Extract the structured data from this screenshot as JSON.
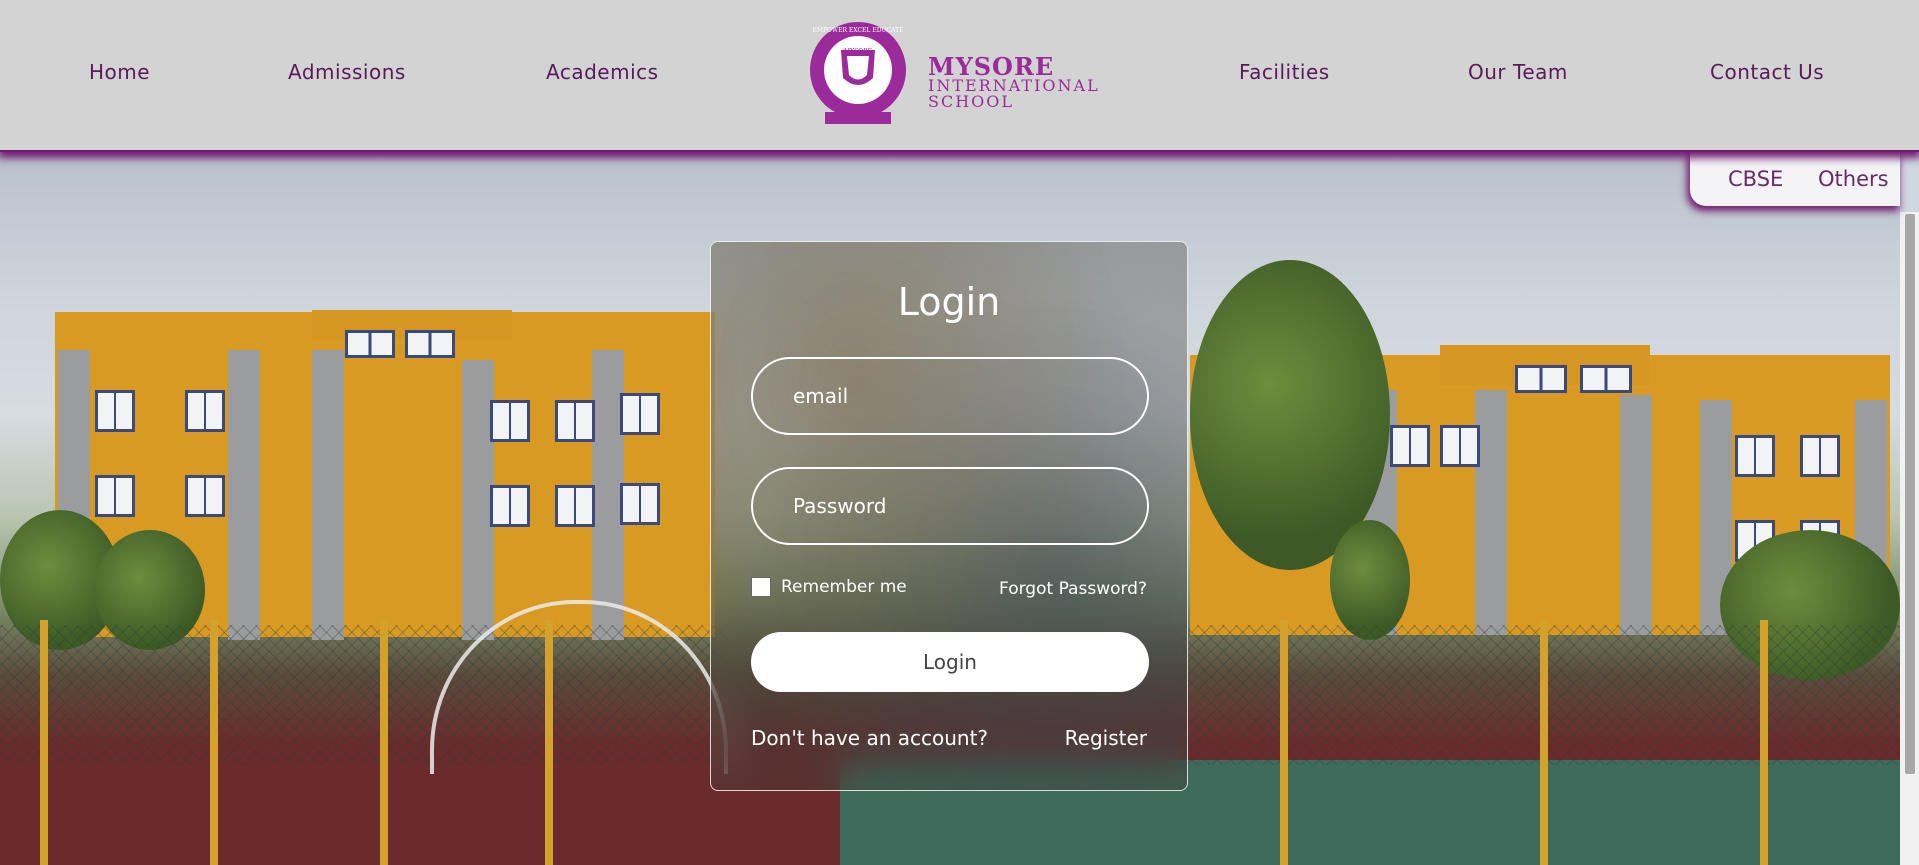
{
  "nav": {
    "items": [
      {
        "label": "Home"
      },
      {
        "label": "Admissions"
      },
      {
        "label": "Academics"
      },
      {
        "label": "Facilities"
      },
      {
        "label": "Our Team"
      },
      {
        "label": "Contact Us"
      }
    ]
  },
  "logo": {
    "line1": "MYSORE",
    "line2": "INTERNATIONAL",
    "line3": "SCHOOL",
    "seal_top": "EMPOWER EXCEL EDUCATE",
    "seal_inner": "MYSORE",
    "color": "#9b2a9b"
  },
  "subtabs": [
    {
      "label": "CBSE"
    },
    {
      "label": "Others"
    }
  ],
  "login": {
    "title": "Login",
    "email_placeholder": "email",
    "password_placeholder": "Password",
    "remember_label": "Remember me",
    "forgot_label": "Forgot Password?",
    "submit_label": "Login",
    "no_account_label": "Don't have an account?",
    "register_label": "Register"
  },
  "colors": {
    "header_bg": "#d3d3d3",
    "accent": "#6f1a6f",
    "nav_text": "#5a1a5a"
  }
}
